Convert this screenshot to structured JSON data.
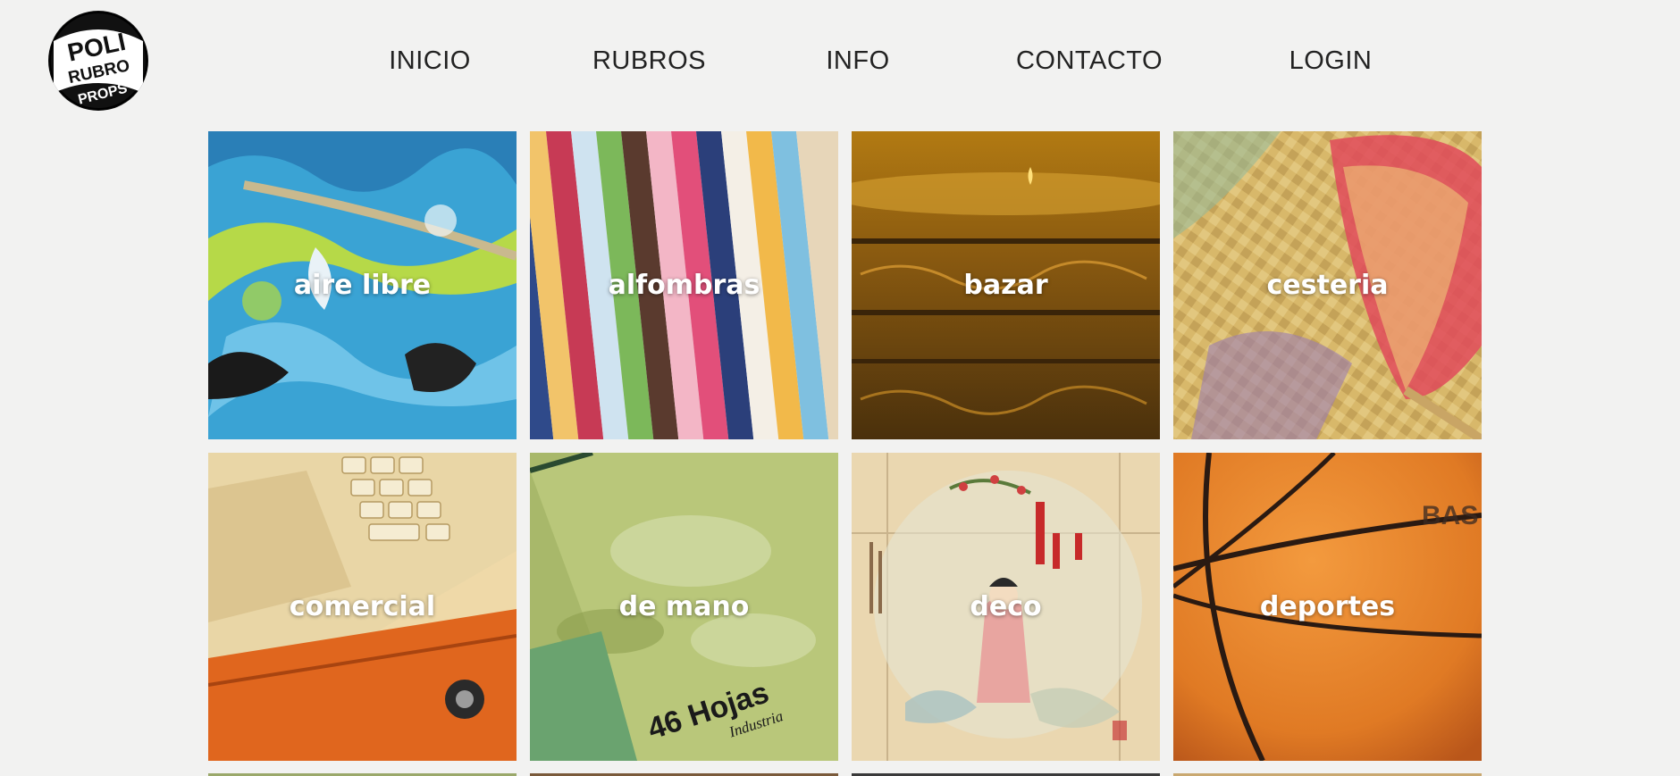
{
  "logo": {
    "lines": [
      "POLI",
      "RUBRO",
      "PROPS"
    ]
  },
  "nav": {
    "items": [
      {
        "label": "INICIO"
      },
      {
        "label": "RUBROS"
      },
      {
        "label": "INFO"
      },
      {
        "label": "CONTACTO"
      },
      {
        "label": "LOGIN"
      }
    ]
  },
  "categories": [
    {
      "label": "aire libre"
    },
    {
      "label": "alfombras"
    },
    {
      "label": "bazar"
    },
    {
      "label": "cesteria"
    },
    {
      "label": "comercial",
      "image_text": ""
    },
    {
      "label": "de mano",
      "image_text": "46 Hojas",
      "image_text_2": "Industria"
    },
    {
      "label": "deco"
    },
    {
      "label": "deportes",
      "image_text": "BAS"
    }
  ],
  "colors": {
    "background": "#f2f2f1",
    "nav_text": "#222222",
    "label_text": "#ffffff"
  }
}
